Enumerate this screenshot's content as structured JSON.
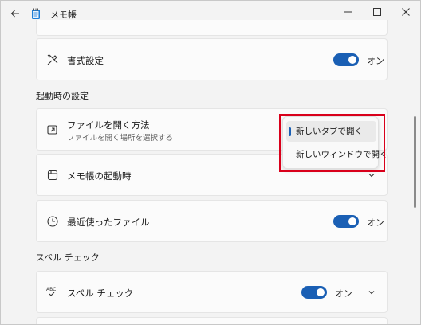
{
  "window": {
    "title": "メモ帳"
  },
  "rows": {
    "format": {
      "title": "書式設定",
      "toggle_label": "オン",
      "toggle_on": true
    },
    "open_file": {
      "title": "ファイルを開く方法",
      "subtitle": "ファイルを開く場所を選択する"
    },
    "startup": {
      "title": "メモ帳の起動時"
    },
    "recent": {
      "title": "最近使ったファイル",
      "toggle_label": "オン",
      "toggle_on": true
    },
    "spell": {
      "title": "スペル チェック",
      "toggle_label": "オン",
      "toggle_on": true
    }
  },
  "sections": {
    "startup_settings": "起動時の設定",
    "spell_check": "スペル チェック"
  },
  "dropdown": {
    "options": [
      {
        "label": "新しいタブで開く",
        "selected": true
      },
      {
        "label": "新しいウィンドウで開く",
        "selected": false
      }
    ]
  },
  "colors": {
    "accent": "#1a5fb4",
    "highlight_box": "#d9001b"
  },
  "icons": {
    "back": "back-arrow-icon",
    "app": "notepad-icon",
    "format": "pen-format-icon",
    "open_file": "open-file-icon",
    "startup": "window-icon",
    "recent": "clock-icon",
    "spell": "spell-check-icon"
  }
}
